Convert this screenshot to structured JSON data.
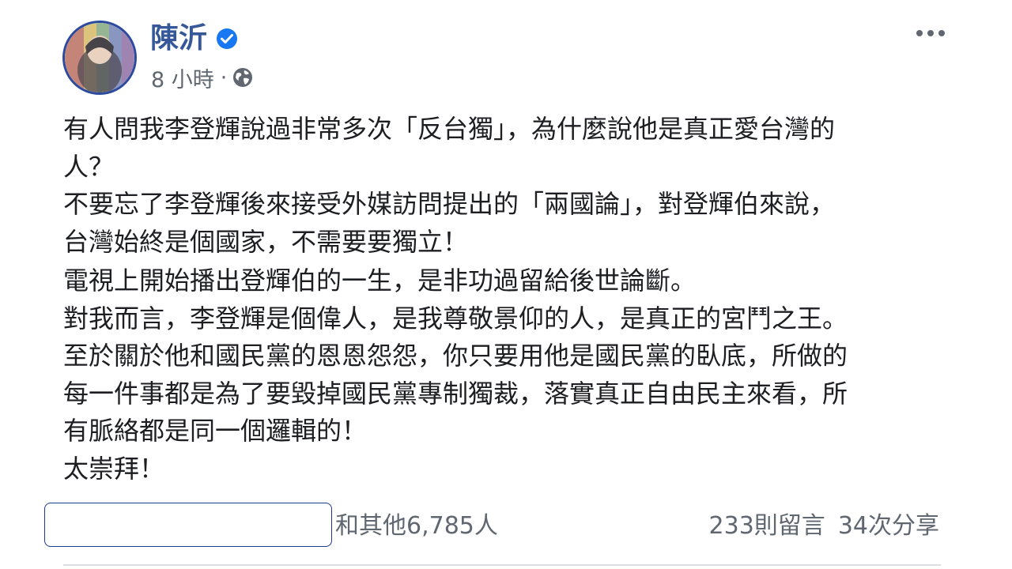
{
  "post": {
    "author": "陳沂",
    "verified": true,
    "timestamp": "8 小時",
    "separator": "·",
    "privacy_icon": "globe-icon",
    "more_icon": "more-options-icon",
    "paragraphs": [
      {
        "lines": [
          "有人問我李登輝說過非常多次「反台獨」，為什麼說他是真正愛台灣的",
          "人？",
          "不要忘了李登輝後來接受外媒訪問提出的「兩國論」，對登輝伯來說，",
          "台灣始終是個國家，不需要要獨立！"
        ]
      },
      {
        "lines": [
          "電視上開始播出登輝伯的一生，是非功過留給後世論斷。",
          "對我而言，李登輝是個偉人，是我尊敬景仰的人，是真正的宮鬥之王。",
          "至於關於他和國民黨的恩恩怨怨，你只要用他是國民黨的臥底，所做的",
          "每一件事都是為了要毀掉國民黨專制獨裁，落實真正自由民主來看，所",
          "有脈絡都是同一個邏輯的！",
          "太崇拜！"
        ]
      }
    ]
  },
  "footer": {
    "reactions_suffix": "和其他6,785人",
    "comments": "233則留言",
    "shares": "34次分享"
  },
  "colors": {
    "author": "#365899",
    "verified": "#1877f2",
    "meta": "#606770",
    "text": "#1c1e21",
    "highlight_box": "#1b3a8c"
  }
}
